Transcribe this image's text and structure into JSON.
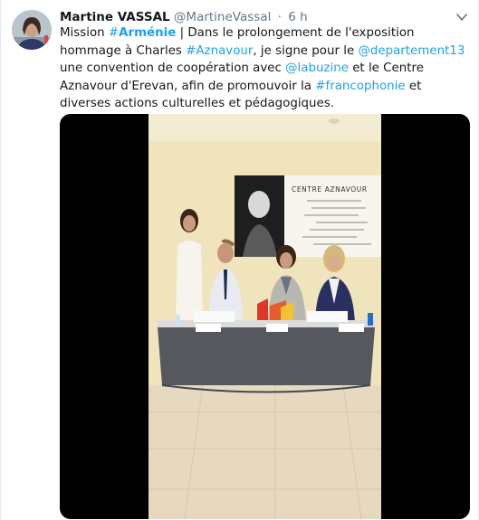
{
  "tweet": {
    "author_name": "Martine VASSAL",
    "author_handle": "@MartineVassal",
    "separator": "·",
    "timestamp": "6 h",
    "body": {
      "t1": "Mission ",
      "hashtag_armenie_hash": "#",
      "hashtag_armenie_word": "Arménie",
      "t2": " | Dans le prolongement de l'exposition hommage à Charles ",
      "hashtag_aznavour": "#Aznavour",
      "t3": ", je signe pour le ",
      "mention_departement": "@departement13",
      "t4": " une convention de coopération avec ",
      "mention_labuzine": "@labuzine",
      "t5": " et le Centre Aznavour d'Erevan, afin de promouvoir la ",
      "hashtag_francophonie": "#francophonie",
      "t6": " et diverses actions culturelles et pédagogiques."
    },
    "video_poster_text": "CENTRE AZNAVOUR",
    "icons": {
      "avatar": "profile-photo",
      "caret": "chevron-down-icon"
    },
    "colors": {
      "link": "#1da1f2",
      "text": "#14171a",
      "muted": "#657786"
    }
  }
}
